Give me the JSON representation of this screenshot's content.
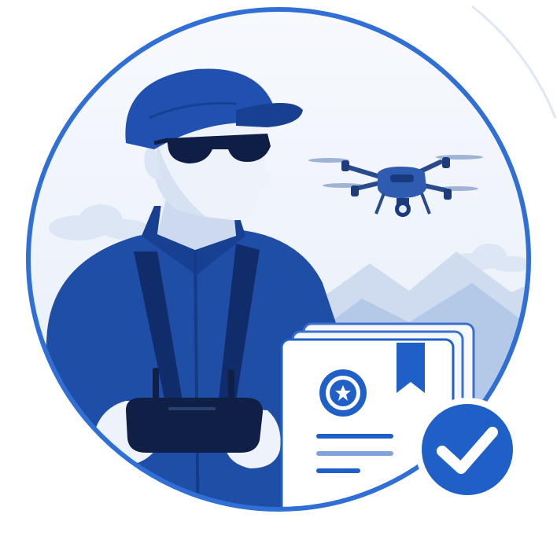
{
  "colors": {
    "primary_blue": "#1f4ea6",
    "deep_blue": "#123a8a",
    "ring_blue": "#2f6fd6",
    "sky_bg": "#f3f6fb",
    "mountain_light": "#c9d7ee",
    "mountain_mid": "#a9bfe3",
    "skin": "#e9eef8",
    "dark_controller": "#0f1f46",
    "check_badge": "#1f5fc8",
    "white": "#ffffff"
  },
  "icons": {
    "badge": "rosette-star-icon",
    "check": "checkmark-icon",
    "bookmark": "bookmark-ribbon-icon",
    "drone": "quadcopter-drone-icon"
  }
}
